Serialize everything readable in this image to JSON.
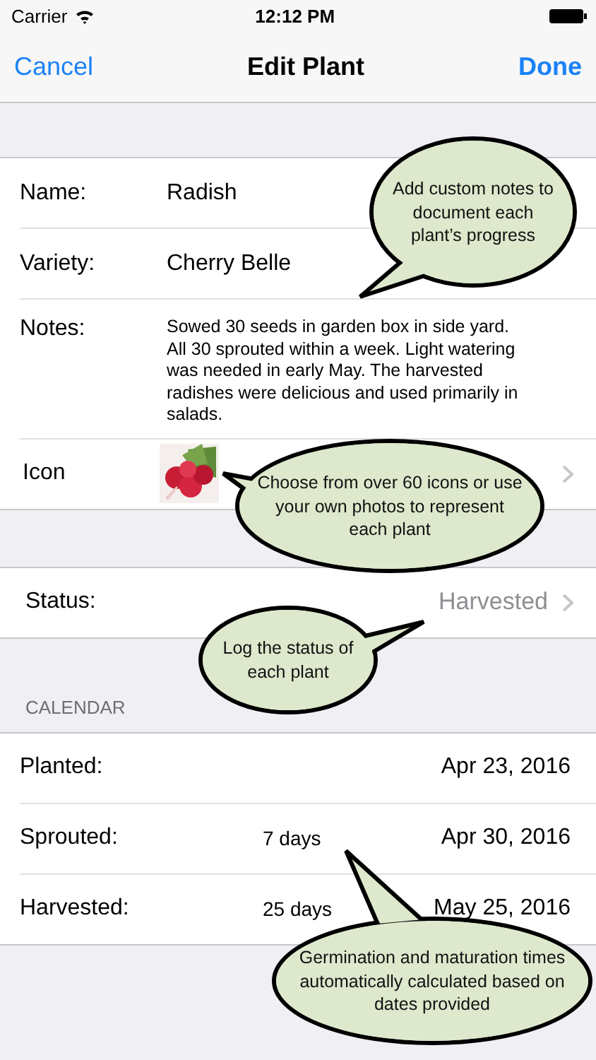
{
  "status_bar": {
    "carrier": "Carrier",
    "time": "12:12 PM"
  },
  "nav": {
    "left": "Cancel",
    "title": "Edit Plant",
    "right": "Done"
  },
  "fields": [
    {
      "kind": "text",
      "label": "Name:",
      "value": "Radish"
    },
    {
      "kind": "text",
      "label": "Variety:",
      "value": "Cherry Belle"
    },
    {
      "kind": "notes",
      "label": "Notes:",
      "value": "Sowed 30 seeds in garden box in side yard. All 30 sprouted within a week. Light watering was needed in early May. The harvested radishes were delicious and used primarily in salads."
    },
    {
      "kind": "icon",
      "label": "Icon"
    }
  ],
  "status": {
    "label": "Status:",
    "value": "Harvested"
  },
  "calendar": {
    "header": "CALENDAR",
    "rows": [
      {
        "label": "Planted:",
        "date": "Apr 23, 2016"
      },
      {
        "label": "Sprouted:",
        "duration": "7 days",
        "date": "Apr 30, 2016"
      },
      {
        "label": "Harvested:",
        "duration": "25 days",
        "date": "May 25, 2016"
      }
    ]
  },
  "callouts": [
    {
      "text": "Add custom notes to document each plant’s progress"
    },
    {
      "text": "Choose from over 60 icons or use your own photos to represent each plant"
    },
    {
      "text": "Log the status of each plant"
    },
    {
      "text": "Germination and maturation times automatically calculated based on dates provided"
    }
  ]
}
